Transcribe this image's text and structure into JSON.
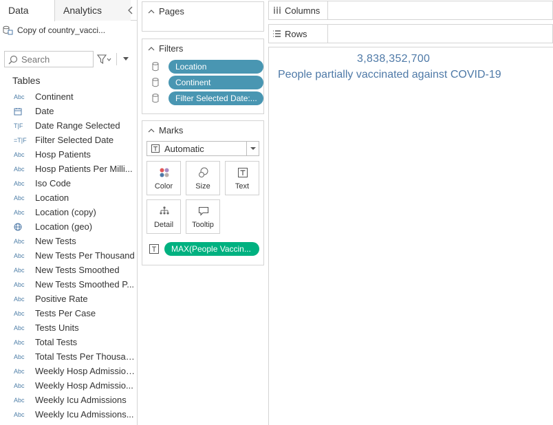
{
  "data_pane": {
    "tabs": [
      {
        "label": "Data"
      },
      {
        "label": "Analytics"
      }
    ],
    "datasource": {
      "name": "Copy of country_vacci..."
    },
    "search": {
      "placeholder": "Search"
    },
    "tables_header": "Tables",
    "fields": [
      {
        "type": "Abc",
        "name": "Continent",
        "icon": "string"
      },
      {
        "type": "",
        "name": "Date",
        "icon": "calendar-icon"
      },
      {
        "type": "T|F",
        "name": "Date Range Selected",
        "icon": "boolean"
      },
      {
        "type": "=T|F",
        "name": "Filter Selected Date",
        "icon": "calc-boolean"
      },
      {
        "type": "Abc",
        "name": "Hosp Patients",
        "icon": "string"
      },
      {
        "type": "Abc",
        "name": "Hosp Patients Per Milli...",
        "icon": "string"
      },
      {
        "type": "Abc",
        "name": "Iso Code",
        "icon": "string"
      },
      {
        "type": "Abc",
        "name": "Location",
        "icon": "string"
      },
      {
        "type": "Abc",
        "name": "Location (copy)",
        "icon": "string"
      },
      {
        "type": "",
        "name": "Location (geo)",
        "icon": "globe-icon"
      },
      {
        "type": "Abc",
        "name": "New Tests",
        "icon": "string"
      },
      {
        "type": "Abc",
        "name": "New Tests Per Thousand",
        "icon": "string"
      },
      {
        "type": "Abc",
        "name": "New Tests Smoothed",
        "icon": "string"
      },
      {
        "type": "Abc",
        "name": "New Tests Smoothed P...",
        "icon": "string"
      },
      {
        "type": "Abc",
        "name": "Positive Rate",
        "icon": "string"
      },
      {
        "type": "Abc",
        "name": "Tests Per Case",
        "icon": "string"
      },
      {
        "type": "Abc",
        "name": "Tests Units",
        "icon": "string"
      },
      {
        "type": "Abc",
        "name": "Total Tests",
        "icon": "string"
      },
      {
        "type": "Abc",
        "name": "Total Tests Per Thousand",
        "icon": "string"
      },
      {
        "type": "Abc",
        "name": "Weekly Hosp Admissions",
        "icon": "string"
      },
      {
        "type": "Abc",
        "name": "Weekly Hosp Admissio...",
        "icon": "string"
      },
      {
        "type": "Abc",
        "name": "Weekly Icu Admissions",
        "icon": "string"
      },
      {
        "type": "Abc",
        "name": "Weekly Icu Admissions...",
        "icon": "string"
      }
    ]
  },
  "pages": {
    "title": "Pages"
  },
  "filters": {
    "title": "Filters",
    "pills": [
      "Location",
      "Continent",
      "Filter Selected Date:..."
    ]
  },
  "marks": {
    "title": "Marks",
    "mark_type": "Automatic",
    "buttons": {
      "color": "Color",
      "size": "Size",
      "text": "Text",
      "detail": "Detail",
      "tooltip": "Tooltip"
    },
    "text_pill": "MAX(People Vaccin..."
  },
  "shelves": {
    "columns": "Columns",
    "rows": "Rows"
  },
  "view": {
    "big_number": "3,838,352,700",
    "caption": "People partially vaccinated against COVID-19"
  },
  "colors": {
    "filter_pill": "#4996b2",
    "measure_pill": "#00b180",
    "text": "#4e79a7"
  }
}
